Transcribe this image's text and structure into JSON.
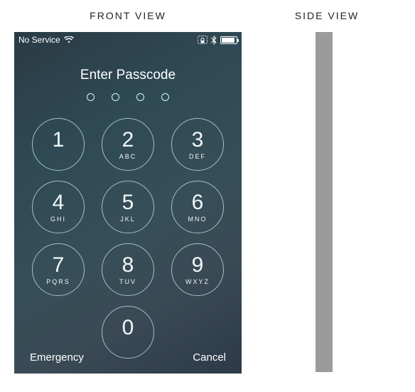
{
  "labels": {
    "front": "FRONT VIEW",
    "side": "SIDE VIEW"
  },
  "status": {
    "service": "No Service"
  },
  "prompt": "Enter Passcode",
  "keypad": [
    {
      "digit": "1",
      "letters": ""
    },
    {
      "digit": "2",
      "letters": "ABC"
    },
    {
      "digit": "3",
      "letters": "DEF"
    },
    {
      "digit": "4",
      "letters": "GHI"
    },
    {
      "digit": "5",
      "letters": "JKL"
    },
    {
      "digit": "6",
      "letters": "MNO"
    },
    {
      "digit": "7",
      "letters": "PQRS"
    },
    {
      "digit": "8",
      "letters": "TUV"
    },
    {
      "digit": "9",
      "letters": "WXYZ"
    },
    {
      "digit": "0",
      "letters": ""
    }
  ],
  "actions": {
    "emergency": "Emergency",
    "cancel": "Cancel"
  }
}
